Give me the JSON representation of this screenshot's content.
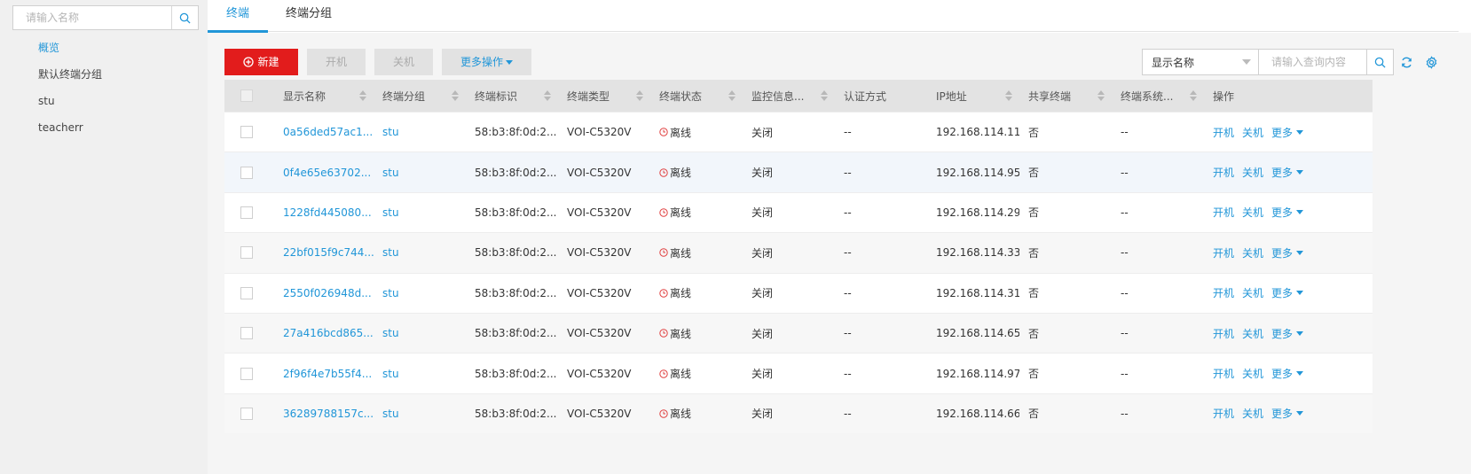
{
  "sidebar": {
    "search_placeholder": "请输入名称",
    "items": [
      {
        "label": "概览",
        "active": true
      },
      {
        "label": "默认终端分组",
        "active": false
      },
      {
        "label": "stu",
        "active": false
      },
      {
        "label": "teacherr",
        "active": false
      }
    ]
  },
  "tabs": [
    {
      "label": "终端",
      "active": true
    },
    {
      "label": "终端分组",
      "active": false
    }
  ],
  "toolbar": {
    "new_label": "新建",
    "power_on_label": "开机",
    "power_off_label": "关机",
    "more_label": "更多操作"
  },
  "filter": {
    "field_selected": "显示名称",
    "query_placeholder": "请输入查询内容"
  },
  "table": {
    "columns": [
      "显示名称",
      "终端分组",
      "终端标识",
      "终端类型",
      "终端状态",
      "监控信息...",
      "认证方式",
      "IP地址",
      "共享终端",
      "终端系统...",
      "操作"
    ],
    "rows": [
      {
        "name": "0a56ded57ac1...",
        "group": "stu",
        "id": "58:b3:8f:0d:2...",
        "type": "VOI-C5320V",
        "status": "离线",
        "monitor": "关闭",
        "auth": "--",
        "ip": "192.168.114.11",
        "shared": "否",
        "system": "--"
      },
      {
        "name": "0f4e65e63702...",
        "group": "stu",
        "id": "58:b3:8f:0d:2...",
        "type": "VOI-C5320V",
        "status": "离线",
        "monitor": "关闭",
        "auth": "--",
        "ip": "192.168.114.95",
        "shared": "否",
        "system": "--"
      },
      {
        "name": "1228fd445080...",
        "group": "stu",
        "id": "58:b3:8f:0d:2...",
        "type": "VOI-C5320V",
        "status": "离线",
        "monitor": "关闭",
        "auth": "--",
        "ip": "192.168.114.29",
        "shared": "否",
        "system": "--"
      },
      {
        "name": "22bf015f9c744...",
        "group": "stu",
        "id": "58:b3:8f:0d:2...",
        "type": "VOI-C5320V",
        "status": "离线",
        "monitor": "关闭",
        "auth": "--",
        "ip": "192.168.114.33",
        "shared": "否",
        "system": "--"
      },
      {
        "name": "2550f026948d...",
        "group": "stu",
        "id": "58:b3:8f:0d:2...",
        "type": "VOI-C5320V",
        "status": "离线",
        "monitor": "关闭",
        "auth": "--",
        "ip": "192.168.114.31",
        "shared": "否",
        "system": "--"
      },
      {
        "name": "27a416bcd865...",
        "group": "stu",
        "id": "58:b3:8f:0d:2...",
        "type": "VOI-C5320V",
        "status": "离线",
        "monitor": "关闭",
        "auth": "--",
        "ip": "192.168.114.65",
        "shared": "否",
        "system": "--"
      },
      {
        "name": "2f96f4e7b55f4...",
        "group": "stu",
        "id": "58:b3:8f:0d:2...",
        "type": "VOI-C5320V",
        "status": "离线",
        "monitor": "关闭",
        "auth": "--",
        "ip": "192.168.114.97",
        "shared": "否",
        "system": "--"
      },
      {
        "name": "36289788157c...",
        "group": "stu",
        "id": "58:b3:8f:0d:2...",
        "type": "VOI-C5320V",
        "status": "离线",
        "monitor": "关闭",
        "auth": "--",
        "ip": "192.168.114.66",
        "shared": "否",
        "system": "--"
      }
    ],
    "row_actions": {
      "on": "开机",
      "off": "关机",
      "more": "更多"
    }
  },
  "colors": {
    "accent": "#2196d8",
    "danger": "#e21c1c",
    "offline": "#e04040"
  },
  "icons": {
    "search": "search-icon",
    "refresh": "refresh-icon",
    "settings": "gear-icon",
    "add": "add-circle-icon",
    "offline": "clock-icon"
  }
}
